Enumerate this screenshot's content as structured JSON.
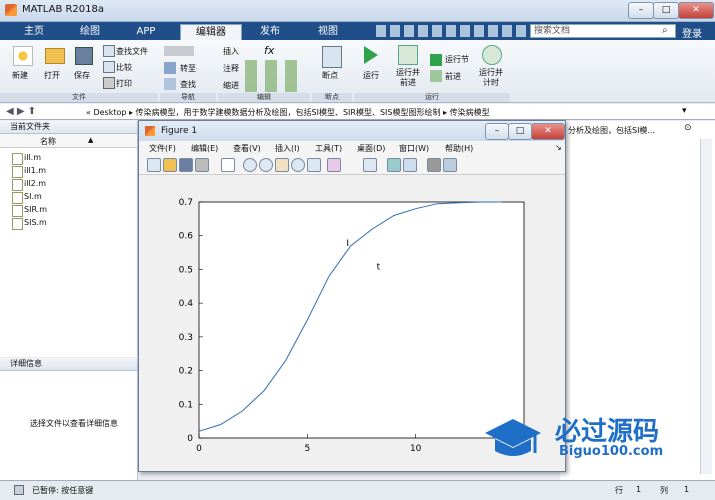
{
  "app_title": "MATLAB R2018a",
  "tabs": [
    "主页",
    "绘图",
    "APP",
    "编辑器",
    "发布",
    "视图"
  ],
  "search_placeholder": "搜索文档",
  "login": "登录",
  "ribbon": {
    "file_group": "文件",
    "nav_group": "导航",
    "edit_group": "编辑",
    "breakpoint_group": "断点",
    "run_group": "运行",
    "new": "新建",
    "open": "打开",
    "save": "保存",
    "find_file": "查找文件",
    "compare": "比较",
    "print": "打印",
    "goto": "转至",
    "find": "查找",
    "insert": "插入",
    "comment": "注释",
    "indent": "缩进",
    "breakpoint": "断点",
    "run": "运行",
    "run_advance": "运行并\n前进",
    "run_section": "运行节",
    "advance": "前进",
    "run_time": "运行并\n计时"
  },
  "breadcrumb": "« Desktop ▸ 传染病模型，用于数学建模数据分析及绘图，包括SI模型、SIR模型、SIS模型图形绘制 ▸ 传染病模型",
  "current_folder": {
    "title": "当前文件夹",
    "column": "名称",
    "sort_arrow": "▲",
    "files": [
      "ill.m",
      "ill1.m",
      "ill2.m",
      "SI.m",
      "SIR.m",
      "SIS.m"
    ]
  },
  "details": {
    "title": "详细信息",
    "message": "选择文件以查看详细信息"
  },
  "right_panel_text": "分析及绘图，包括SI模...",
  "status": {
    "text": "已暂停: 按任意键",
    "row_label": "行",
    "row": "1",
    "col_label": "列",
    "col": "1"
  },
  "figure": {
    "title": "Figure 1",
    "menu": [
      "文件(F)",
      "编辑(E)",
      "查看(V)",
      "插入(I)",
      "工具(T)",
      "桌面(D)",
      "窗口(W)",
      "帮助(H)"
    ]
  },
  "chart_data": {
    "type": "line",
    "x": [
      0,
      1,
      2,
      3,
      4,
      5,
      6,
      7,
      8,
      9,
      10,
      11,
      12,
      13,
      14
    ],
    "y": [
      0.02,
      0.04,
      0.08,
      0.14,
      0.23,
      0.35,
      0.48,
      0.57,
      0.62,
      0.66,
      0.68,
      0.695,
      0.698,
      0.7,
      0.7
    ],
    "xlim": [
      0,
      15
    ],
    "ylim": [
      0,
      0.7
    ],
    "xticks": [
      "0",
      "5",
      "10"
    ],
    "yticks": [
      "0",
      "0.1",
      "0.2",
      "0.3",
      "0.4",
      "0.5",
      "0.6",
      "0.7"
    ],
    "annotations": [
      "I",
      "t"
    ],
    "title": "",
    "xlabel": "",
    "ylabel": "",
    "grid": false,
    "line_color": "#2e6eb5"
  },
  "logo": {
    "name": "必过源码",
    "url": "Biguo100.com"
  }
}
